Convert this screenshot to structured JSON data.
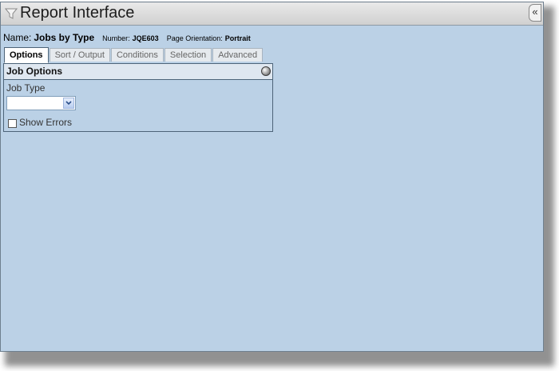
{
  "window": {
    "title": "Report Interface",
    "collapse_label": "«"
  },
  "info": {
    "name_label": "Name:",
    "name_value": "Jobs by Type",
    "number_label": "Number:",
    "number_value": "JQE603",
    "orientation_label": "Page Orientation:",
    "orientation_value": "Portrait"
  },
  "tabs": [
    {
      "label": "Options",
      "active": true
    },
    {
      "label": "Sort / Output",
      "active": false
    },
    {
      "label": "Conditions",
      "active": false
    },
    {
      "label": "Selection",
      "active": false
    },
    {
      "label": "Advanced",
      "active": false
    }
  ],
  "panel": {
    "title": "Job Options",
    "job_type_label": "Job Type",
    "job_type_value": "",
    "show_errors_label": "Show Errors",
    "show_errors_checked": false
  },
  "icons": {
    "title_icon": "filter-icon",
    "collapse_icon": "double-chevron-left-icon",
    "panel_icon": "sphere-icon",
    "dropdown_icon": "chevron-down-icon"
  },
  "colors": {
    "background": "#bbd1e6",
    "titlebar": "#dcdcdc",
    "border": "#4d6479"
  }
}
